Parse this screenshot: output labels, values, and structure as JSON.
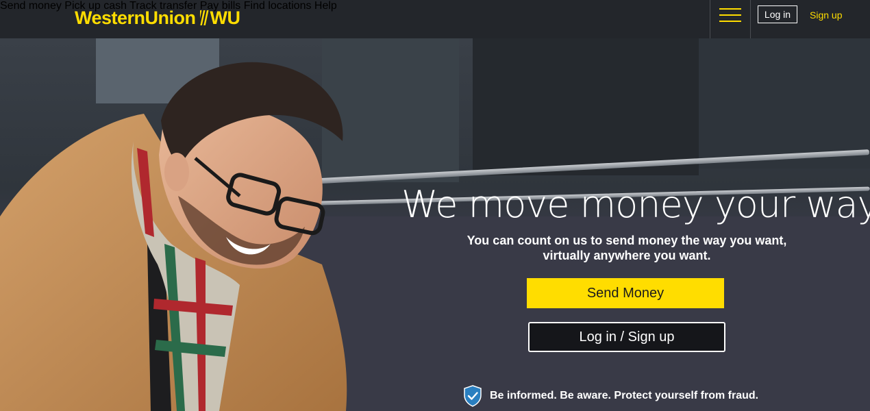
{
  "header": {
    "logo_text": "WesternUnion",
    "logo_mark": "WU",
    "nav": [
      {
        "label": "Send money"
      },
      {
        "label": "Pick up cash"
      },
      {
        "label": "Track transfer"
      },
      {
        "label": "Pay bills"
      },
      {
        "label": "Find locations"
      },
      {
        "label": "Help"
      }
    ],
    "menu_icon": "hamburger-menu-icon",
    "login_label": "Log in",
    "signup_label": "Sign up"
  },
  "hero": {
    "headline": "We move money your way",
    "subtext_line1": "You can count on us to send money the way you want,",
    "subtext_line2": "virtually anywhere you want.",
    "send_button": "Send Money",
    "login_button": "Log in / Sign up",
    "fraud_icon": "shield-check-icon",
    "fraud_text": "Be informed. Be aware. Protect yourself from fraud."
  },
  "colors": {
    "brand_yellow": "#ffdd00",
    "header_bg": "#23262b",
    "button_dark": "#15161a"
  }
}
